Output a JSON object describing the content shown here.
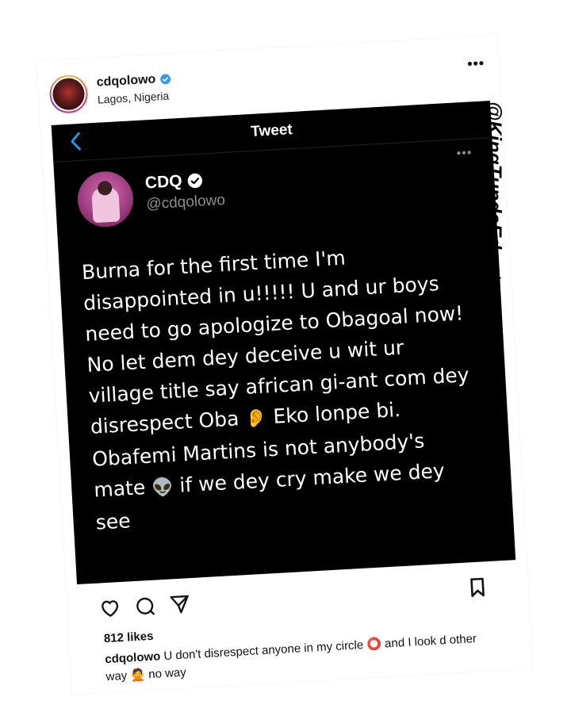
{
  "post": {
    "username": "cdqolowo",
    "location": "Lagos, Nigeria",
    "more_label": "•••"
  },
  "tweet": {
    "nav_title": "Tweet",
    "more_label": "•••",
    "name": "CDQ",
    "handle": "@cdqolowo",
    "text_parts": {
      "p1": "Burna for the first time I'm disappointed in u!!!!! U and ur boys need to go apologize to Obagoal now! No let dem dey deceive u wit ur village title say african gi-ant com dey disrespect Oba",
      "e1": "👂",
      "p2": " Eko lonpe bi. Obafemi Martins is not anybody's mate",
      "e2": "👽",
      "p3": " if we dey cry make we dey see"
    }
  },
  "engagement": {
    "likes": "812 likes",
    "caption_user": "cdqolowo",
    "caption_p1": " U don't disrespect anyone in my circle",
    "caption_e1": "⭕",
    "caption_p2": " and I look d other way",
    "caption_e2": "🙅",
    "caption_p3": " no way"
  },
  "watermark": "@KingTundeEdnut",
  "colors": {
    "tweet_bg": "#000000",
    "accent_blue": "#1d9bf0",
    "verified_blue": "#3897f0",
    "handle_gray": "#8e8e93"
  },
  "icons": [
    "verified-icon",
    "back-chevron-icon",
    "heart-icon",
    "comment-icon",
    "share-icon",
    "bookmark-icon"
  ]
}
